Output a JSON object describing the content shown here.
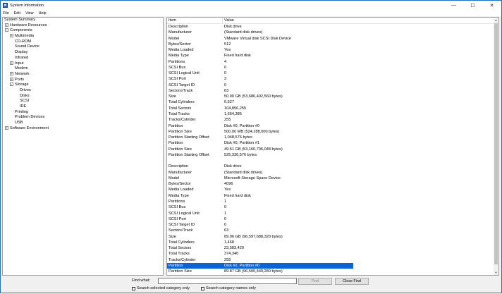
{
  "window": {
    "title": "System Information",
    "controls": {
      "minimize": "—",
      "maximize": "☐",
      "close": "✕"
    }
  },
  "menu": [
    "File",
    "Edit",
    "View",
    "Help"
  ],
  "tree": [
    {
      "label": "System Summary",
      "level": 0,
      "toggle": ""
    },
    {
      "label": "Hardware Resources",
      "level": 1,
      "toggle": "+"
    },
    {
      "label": "Components",
      "level": 1,
      "toggle": "-"
    },
    {
      "label": "Multimedia",
      "level": 2,
      "toggle": "+"
    },
    {
      "label": "CD-ROM",
      "level": 2,
      "toggle": ""
    },
    {
      "label": "Sound Device",
      "level": 2,
      "toggle": ""
    },
    {
      "label": "Display",
      "level": 2,
      "toggle": ""
    },
    {
      "label": "Infrared",
      "level": 2,
      "toggle": ""
    },
    {
      "label": "Input",
      "level": 2,
      "toggle": "+"
    },
    {
      "label": "Modem",
      "level": 2,
      "toggle": ""
    },
    {
      "label": "Network",
      "level": 2,
      "toggle": "+"
    },
    {
      "label": "Ports",
      "level": 2,
      "toggle": "+"
    },
    {
      "label": "Storage",
      "level": 2,
      "toggle": "-"
    },
    {
      "label": "Drives",
      "level": 3,
      "toggle": ""
    },
    {
      "label": "Disks",
      "level": 3,
      "toggle": ""
    },
    {
      "label": "SCSI",
      "level": 3,
      "toggle": ""
    },
    {
      "label": "IDE",
      "level": 3,
      "toggle": ""
    },
    {
      "label": "Printing",
      "level": 2,
      "toggle": ""
    },
    {
      "label": "Problem Devices",
      "level": 2,
      "toggle": ""
    },
    {
      "label": "USB",
      "level": 2,
      "toggle": ""
    },
    {
      "label": "Software Environment",
      "level": 1,
      "toggle": "+"
    }
  ],
  "list": {
    "headers": {
      "item": "Item",
      "value": "Value"
    },
    "rows": [
      {
        "item": "Description",
        "value": "Disk drive"
      },
      {
        "item": "Manufacturer",
        "value": "(Standard disk drives)"
      },
      {
        "item": "Model",
        "value": "VMware Virtual disk SCSI Disk Device"
      },
      {
        "item": "Bytes/Sector",
        "value": "512"
      },
      {
        "item": "Media Loaded",
        "value": "Yes"
      },
      {
        "item": "Media Type",
        "value": "Fixed hard disk"
      },
      {
        "item": "Partitions",
        "value": "4"
      },
      {
        "item": "SCSI Bus",
        "value": "0"
      },
      {
        "item": "SCSI Logical Unit",
        "value": "0"
      },
      {
        "item": "SCSI Port",
        "value": "3"
      },
      {
        "item": "SCSI Target ID",
        "value": "0"
      },
      {
        "item": "Sectors/Track",
        "value": "63"
      },
      {
        "item": "Size",
        "value": "50.00 GB (53,686,402,560 bytes)"
      },
      {
        "item": "Total Cylinders",
        "value": "6,527"
      },
      {
        "item": "Total Sectors",
        "value": "104,856,255"
      },
      {
        "item": "Total Tracks",
        "value": "1,664,385"
      },
      {
        "item": "Tracks/Cylinder",
        "value": "255"
      },
      {
        "item": "Partition",
        "value": "Disk #0, Partition #0"
      },
      {
        "item": "Partition Size",
        "value": "500.00 MB (524,288,000 bytes)"
      },
      {
        "item": "Partition Starting Offset",
        "value": "1,048,576 bytes"
      },
      {
        "item": "Partition",
        "value": "Disk #0, Partition #1"
      },
      {
        "item": "Partition Size",
        "value": "49.51 GB (53,160,706,048 bytes)"
      },
      {
        "item": "Partition Starting Offset",
        "value": "525,336,576 bytes"
      },
      {
        "item": "",
        "value": ""
      },
      {
        "item": "Description",
        "value": "Disk drive"
      },
      {
        "item": "Manufacturer",
        "value": "(Standard disk drives)"
      },
      {
        "item": "Model",
        "value": "Microsoft Storage Space Device"
      },
      {
        "item": "Bytes/Sector",
        "value": "4096"
      },
      {
        "item": "Media Loaded",
        "value": "Yes"
      },
      {
        "item": "Media Type",
        "value": "Fixed hard disk"
      },
      {
        "item": "Partitions",
        "value": "1"
      },
      {
        "item": "SCSI Bus",
        "value": "0"
      },
      {
        "item": "SCSI Logical Unit",
        "value": "1"
      },
      {
        "item": "SCSI Port",
        "value": "0"
      },
      {
        "item": "SCSI Target ID",
        "value": "0"
      },
      {
        "item": "Sectors/Track",
        "value": "63"
      },
      {
        "item": "Size",
        "value": "89.96 GB (96,597,688,320 bytes)"
      },
      {
        "item": "Total Cylinders",
        "value": "1,468"
      },
      {
        "item": "Total Sectors",
        "value": "23,583,420"
      },
      {
        "item": "Total Tracks",
        "value": "374,340"
      },
      {
        "item": "Tracks/Cylinder",
        "value": "255"
      },
      {
        "item": "Partition",
        "value": "Disk #2, Partition #0",
        "selected": true
      },
      {
        "item": "Partition Size",
        "value": "89.87 GB (96,500,449,280 bytes)"
      }
    ]
  },
  "find": {
    "label": "Find what:",
    "value": "",
    "find_button": "Find",
    "close_button": "Close Find",
    "search_selected": "Search selected category only",
    "search_names": "Search category names only"
  },
  "colors": {
    "selection": "#0a64d8",
    "border_accent": "#1e73c8"
  }
}
